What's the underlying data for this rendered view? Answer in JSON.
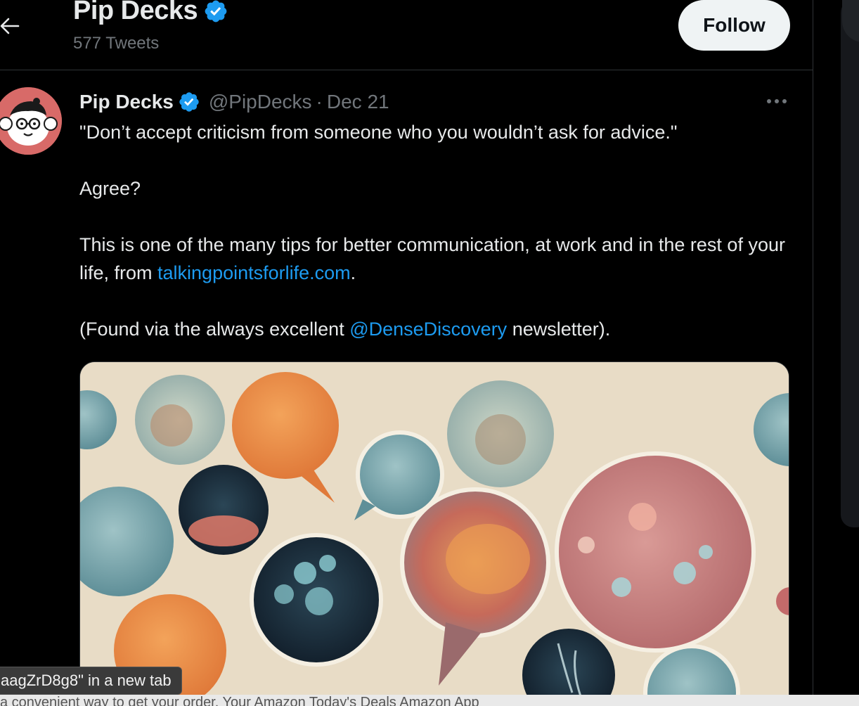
{
  "header": {
    "name": "Pip Decks",
    "tweet_count": "577 Tweets",
    "follow_label": "Follow"
  },
  "tweet": {
    "author": "Pip Decks",
    "handle": "@PipDecks",
    "separator": "·",
    "date": "Dec 21",
    "quote": "\"Don’t accept criticism from someone who you wouldn’t ask for advice.\"",
    "question": "Agree?",
    "body_before_link": "This is one of the many tips for better communication, at work and in the rest of your life, from ",
    "link_text": "talkingpointsforlife.com",
    "body_after_link": ".",
    "found_before": "(Found via the always excellent ",
    "mention": "@DenseDiscovery",
    "found_after": " newsletter)."
  },
  "status_bar": {
    "text": "aagZrD8g8\" in a new tab"
  },
  "bottom_strip": {
    "text": "a convenient way to get your order. Your Amazon Today's Deals Amazon App"
  },
  "colors": {
    "accent_link": "#1d9bf0",
    "verified": "#1d9bf0",
    "background": "#000000",
    "secondary_text": "#71767b"
  },
  "icons": [
    "back-arrow-icon",
    "verified-badge-icon",
    "more-options-icon"
  ]
}
